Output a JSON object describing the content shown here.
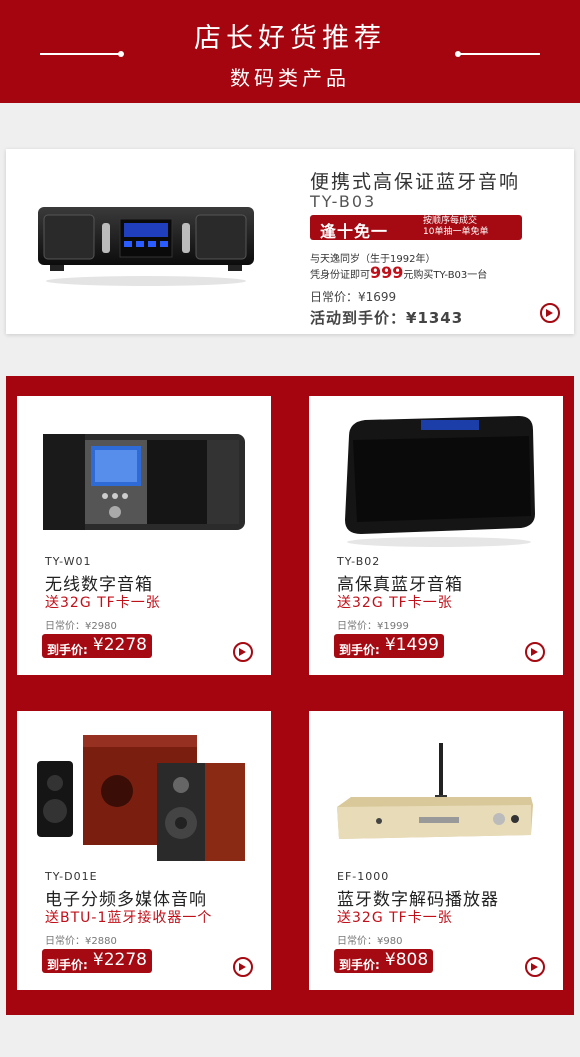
{
  "header": {
    "title": "店长好货推荐",
    "subtitle": "数码类产品"
  },
  "featured": {
    "name": "便携式高保证蓝牙音响",
    "model": "TY-B03",
    "promo_main": "逢十免一",
    "promo_side_1": "按顺序每成交",
    "promo_side_2": "10单抽一单免单",
    "note1": "与天逸同岁（生于1992年）",
    "note2_pre": "凭身份证即可",
    "note2_price": "999",
    "note2_post": "元购买TY-B03一台",
    "regular_price": "日常价：¥1699",
    "activity_price": "活动到手价：¥1343"
  },
  "products": [
    {
      "model": "TY-W01",
      "name": "无线数字音箱",
      "gift": "送32G TF卡一张",
      "regular_price": "日常价：¥2980",
      "price_label": "到手价:",
      "price_value": "¥2278"
    },
    {
      "model": "TY-B02",
      "name": "高保真蓝牙音箱",
      "gift": "送32G TF卡一张",
      "regular_price": "日常价：¥1999",
      "price_label": "到手价:",
      "price_value": "¥1499"
    },
    {
      "model": "TY-D01E",
      "name": "电子分频多媒体音响",
      "gift": "送BTU-1蓝牙接收器一个",
      "regular_price": "日常价：¥2880",
      "price_label": "到手价:",
      "price_value": "¥2278"
    },
    {
      "model": "EF-1000",
      "name": "蓝牙数字解码播放器",
      "gift": "送32G TF卡一张",
      "regular_price": "日常价：¥980",
      "price_label": "到手价:",
      "price_value": "¥808"
    }
  ],
  "colors": {
    "brand_red": "#a4050f",
    "price_red": "#c0101a"
  }
}
